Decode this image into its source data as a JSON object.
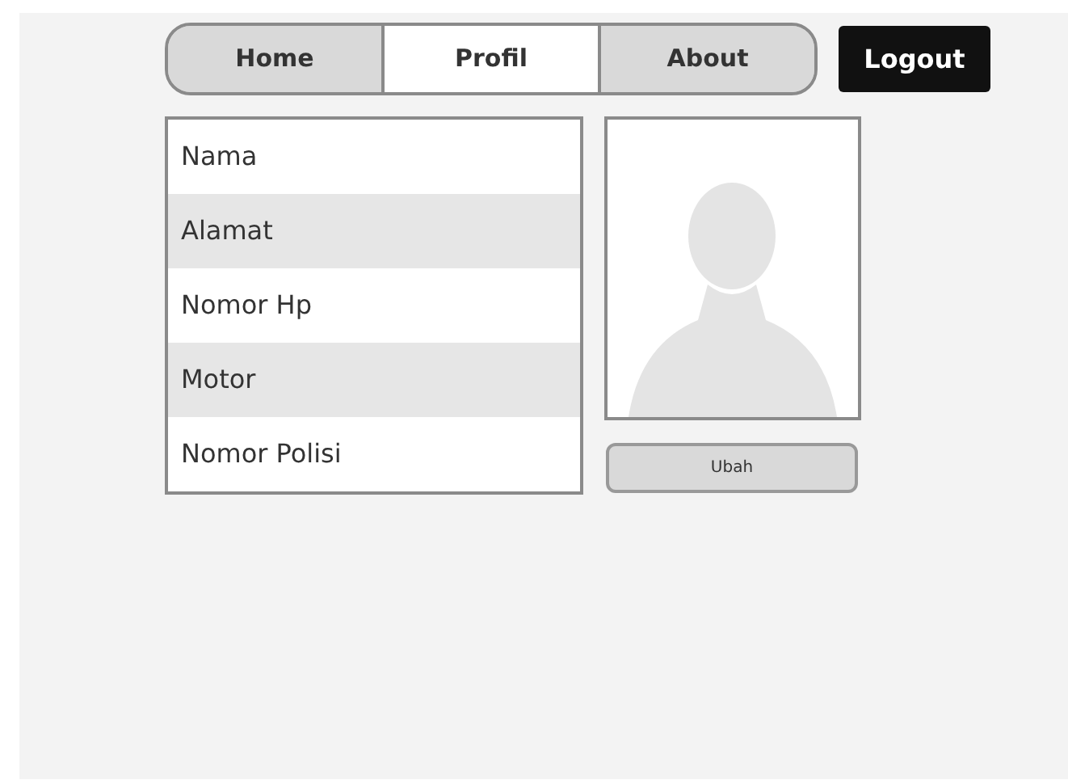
{
  "nav": {
    "tabs": [
      {
        "label": "Home",
        "selected": false
      },
      {
        "label": "Profil",
        "selected": true
      },
      {
        "label": "About",
        "selected": false
      }
    ],
    "logout": "Logout"
  },
  "fields": [
    {
      "label": "Nama",
      "shaded": false
    },
    {
      "label": "Alamat",
      "shaded": true
    },
    {
      "label": "Nomor Hp",
      "shaded": false
    },
    {
      "label": "Motor",
      "shaded": true
    },
    {
      "label": "Nomor Polisi",
      "shaded": false
    }
  ],
  "photo": {
    "button": "Ubah"
  }
}
